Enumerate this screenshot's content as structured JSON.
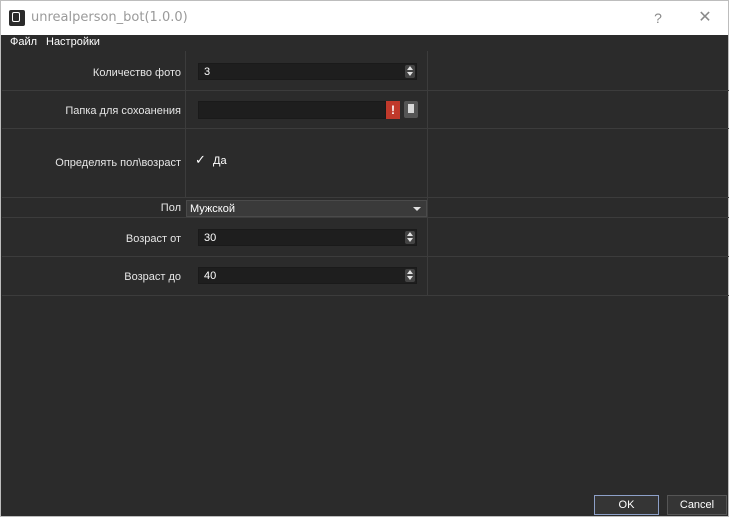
{
  "window": {
    "title": "unrealperson_bot(1.0.0)",
    "help": "?",
    "close": "✕"
  },
  "menu": {
    "items": [
      "Файл",
      "Настройки"
    ]
  },
  "form": {
    "photo_count": {
      "label": "Количество фото",
      "value": "3"
    },
    "save_folder": {
      "label": "Папка для сохоанения",
      "value": "",
      "warning": "!"
    },
    "detect_gender_age": {
      "label": "Определять пол\\возраст",
      "checked": true,
      "check_mark": "✓",
      "check_label": "Да"
    },
    "gender": {
      "label": "Пол",
      "value": "Мужской"
    },
    "age_from": {
      "label": "Возраст от",
      "value": "30"
    },
    "age_to": {
      "label": "Возраст до",
      "value": "40"
    }
  },
  "buttons": {
    "ok": "OK",
    "cancel": "Cancel"
  },
  "colors": {
    "background": "#2b2b2b",
    "input_bg": "#1e1e1e",
    "warning": "#c0392b",
    "ok_border": "#8da0c8"
  }
}
